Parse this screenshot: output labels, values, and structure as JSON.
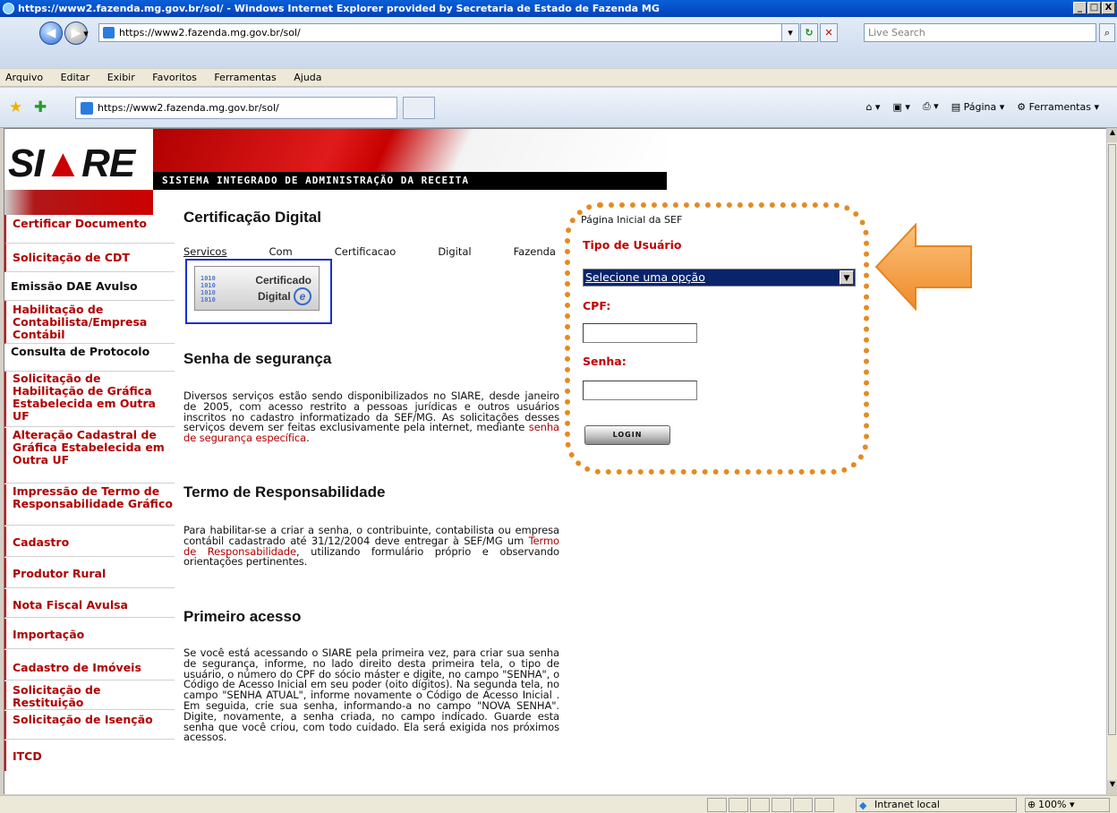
{
  "window": {
    "title": "https://www2.fazenda.mg.gov.br/sol/ - Windows Internet Explorer provided by Secretaria de Estado de Fazenda MG",
    "buttons": [
      "_",
      "□",
      "X"
    ]
  },
  "address_bar": {
    "url": "https://www2.fazenda.mg.gov.br/sol/",
    "search_placeholder": "Live Search"
  },
  "menu": [
    "Arquivo",
    "Editar",
    "Exibir",
    "Favoritos",
    "Ferramentas",
    "Ajuda"
  ],
  "tab": {
    "title": "https://www2.fazenda.mg.gov.br/sol/"
  },
  "command_bar": {
    "page_label": "Página",
    "tools_label": "Ferramentas"
  },
  "banner": {
    "logo": "SIARE",
    "logo_left": "SI",
    "logo_tri": "▲",
    "logo_right": "RE",
    "subtitle": "SISTEMA INTEGRADO DE ADMINISTRAÇÃO DA RECEITA"
  },
  "sidebar": {
    "items": [
      {
        "label": "Certificar Documento"
      },
      {
        "label": "Solicitação de CDT"
      },
      {
        "label": "Emissão DAE Avulso"
      },
      {
        "label": "Habilitação de Contabilista/Empresa Contábil"
      },
      {
        "label": "Consulta de Protocolo"
      },
      {
        "label": "Solicitação de Habilitação de Gráfica Estabelecida em Outra UF"
      },
      {
        "label": "Alteração Cadastral de Gráfica Estabelecida em Outra UF"
      },
      {
        "label": "Impressão de Termo de Responsabilidade Gráfico"
      },
      {
        "label": "Cadastro"
      },
      {
        "label": "Produtor Rural"
      },
      {
        "label": "Nota Fiscal Avulsa"
      },
      {
        "label": "Importação"
      },
      {
        "label": "Cadastro de Imóveis"
      },
      {
        "label": "Solicitação de Restituição"
      },
      {
        "label": "Solicitação de Isenção"
      },
      {
        "label": "ITCD"
      }
    ]
  },
  "main": {
    "cert_title": "Certificação Digital",
    "services_words": [
      "Servicos",
      "Com",
      "Certificacao",
      "Digital",
      "Fazenda"
    ],
    "cert_button_line1": "Certificado",
    "cert_button_line2": "Digital",
    "cert_button_logo": "e",
    "cert_binary": "1010\n1010\n1010\n1010",
    "senha_title": "Senha de segurança",
    "senha_text": "Diversos serviços estão sendo disponibilizados no SIARE, desde janeiro de 2005, com acesso restrito a pessoas jurídicas e outros usuários inscritos no cadastro informatizado da SEF/MG. As solicitações desses serviços devem ser feitas exclusivamente pela internet, mediante ",
    "senha_link": "senha de segurança específica",
    "senha_end": ".",
    "termo_title": "Termo de Responsabilidade",
    "termo_text_pre": "Para habilitar-se a criar a senha, o contribuinte, contabilista ou empresa contábil cadastrado até 31/12/2004 deve entregar à SEF/MG um ",
    "termo_link": "Termo de Responsabilidade",
    "termo_text_post": ", utilizando formulário próprio e observando orientações pertinentes.",
    "primeiro_title": "Primeiro acesso",
    "primeiro_text": "Se você está acessando o SIARE pela primeira vez, para criar sua senha de segurança, informe, no lado direito desta primeira tela, o tipo de usuário, o número do CPF do sócio máster e digite, no campo \"SENHA\", o Código de Acesso Inicial em seu poder (oito dígitos). Na segunda tela, no campo \"SENHA ATUAL\", informe novamente o Código de Acesso Inicial . Em seguida, crie sua senha, informando-a no campo \"NOVA SENHA\". Digite, novamente, a senha criada, no campo indicado. Guarde esta senha que você criou, com todo cuidado. Ela será exigida nos próximos acessos."
  },
  "login": {
    "home_link": "Página Inicial da SEF",
    "tipo_label": "Tipo de Usuário",
    "tipo_value": "Selecione uma opção",
    "cpf_label": "CPF:",
    "cpf_value": "",
    "senha_label": "Senha:",
    "senha_value": "",
    "button": "LOGIN"
  },
  "status": {
    "zone": "Intranet local",
    "zoom": "100%"
  },
  "colors": {
    "accent_red": "#cc0000",
    "highlight_orange": "#e58a22",
    "titlebar_blue": "#0142b8"
  }
}
